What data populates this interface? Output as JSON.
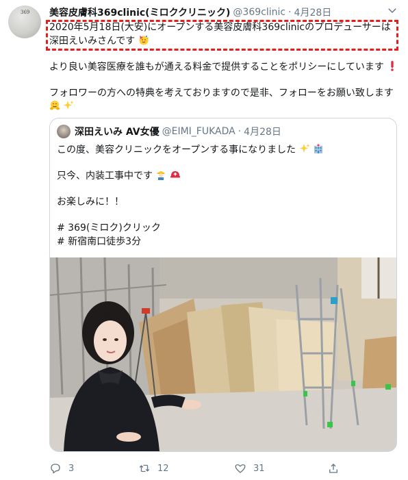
{
  "tweet": {
    "author_name": "美容皮膚科369clinic(ミロククリニック)",
    "author_handle": "@369clinic",
    "separator": "·",
    "date": "4月28日",
    "avatar_label": "369",
    "line1": "2020年5月18日(大安)にオープンする美容皮膚科369clinicのプロデューサーは",
    "line2": "深田えいみさんです",
    "line3": "より良い美容医療を誰もが通える料金で提供することをポリシーにしています",
    "line4": "フォロワーの方への特典を考えておりますので是非、フォローをお願い致します"
  },
  "quoted": {
    "author_name": "深田えいみ AV女優",
    "author_handle": "@EIMI_FUKADA",
    "separator": "·",
    "date": "4月28日",
    "line1": "この度、美容クリニックをオープンする事になりました",
    "line2": "只今、内装工事中です",
    "line3": "お楽しみに！！",
    "line4": "# 369(ミロク)クリック",
    "line5": "# 新宿南口徒歩3分"
  },
  "actions": {
    "reply_count": "3",
    "retweet_count": "12",
    "like_count": "31"
  },
  "colors": {
    "highlight_border": "#e81c1c",
    "secondary_text": "#657786",
    "card_border": "#ccd6dd"
  }
}
